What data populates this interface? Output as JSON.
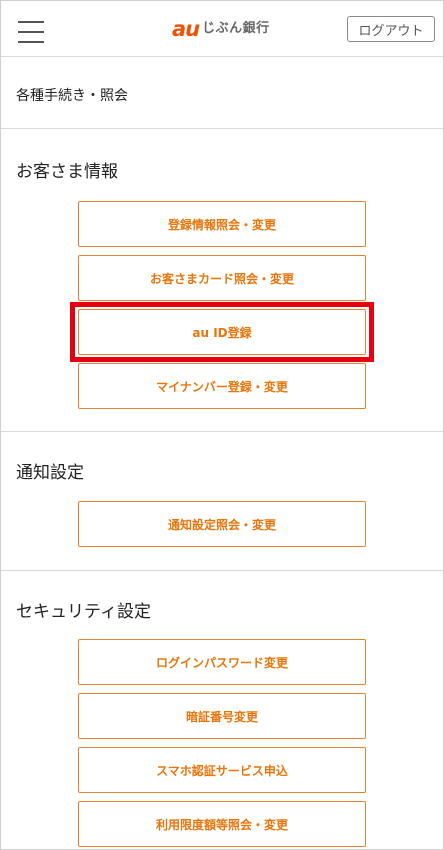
{
  "header": {
    "menu_icon": "hamburger-icon",
    "logo_au": "au",
    "logo_bank": "じぶん銀行",
    "logout_label": "ログアウト"
  },
  "breadcrumb": {
    "label": "各種手続き・照会"
  },
  "colors": {
    "accent": "#e8760c",
    "highlight": "#e60012",
    "logo": "#eb5505"
  },
  "sections": {
    "profile": {
      "title": "お客さま情報",
      "buttons": [
        "登録情報照会・変更",
        "お客さまカード照会・変更",
        "au ID登録",
        "マイナンバー登録・変更"
      ]
    },
    "notify": {
      "title": "通知設定",
      "buttons": [
        "通知設定照会・変更"
      ]
    },
    "security": {
      "title": "セキュリティ設定",
      "buttons": [
        "ログインパスワード変更",
        "暗証番号変更",
        "スマホ認証サービス申込",
        "利用限度額等照会・変更"
      ]
    }
  }
}
